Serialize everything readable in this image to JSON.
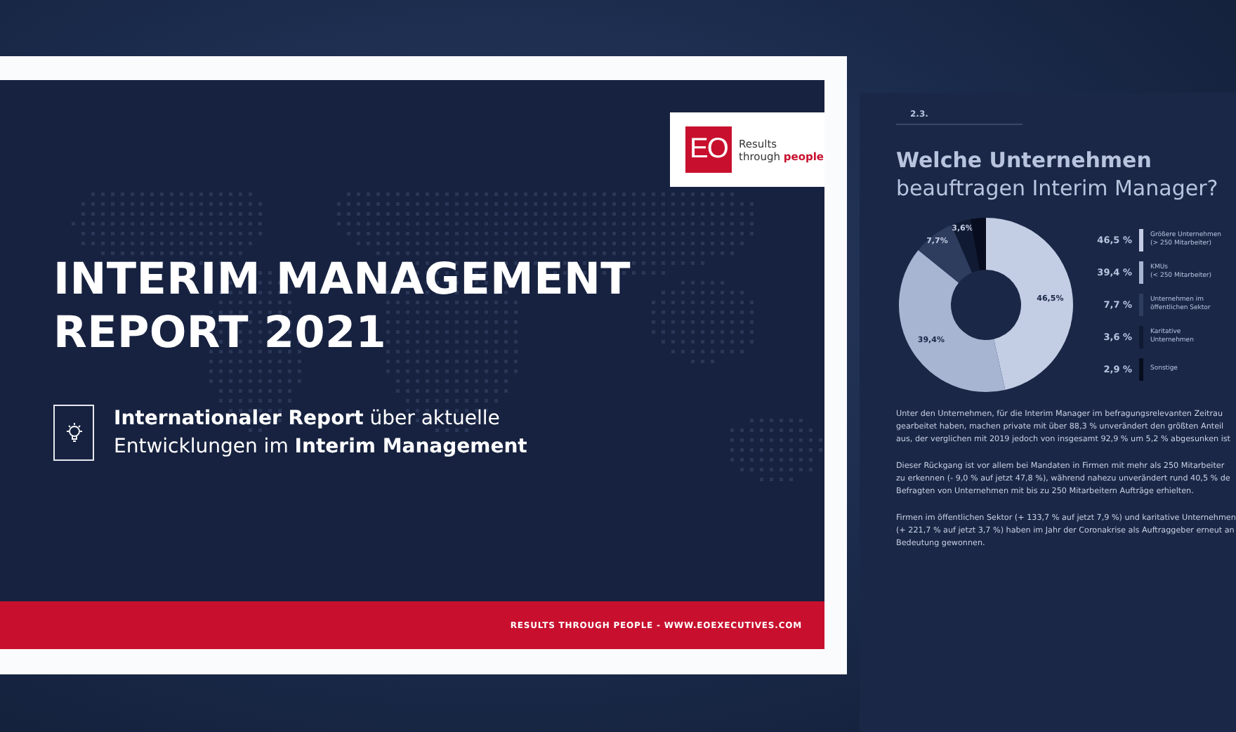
{
  "cover": {
    "logo": {
      "mark": "EO",
      "line_1": "Results",
      "line_2": "through **people**"
    },
    "title_lines": [
      "INTERIM MANAGEMENT",
      "REPORT 2021"
    ],
    "subtitle": "**Internationaler Report** über aktuelle Entwicklungen im **Interim Management**",
    "footer": "RESULTS THROUGH PEOPLE - WWW.EOEXECUTIVES.COM"
  },
  "page": {
    "section": "2.3.",
    "title_bold": "Welche Unternehmen",
    "title_light": "beauftragen Interim Manager?",
    "chart_data": {
      "type": "donut",
      "values": [
        46.5,
        39.4,
        7.7,
        3.6,
        2.9
      ],
      "value_labels": [
        "46,5%",
        "39,4%",
        "7,7%",
        "3,6%",
        null
      ]
    },
    "legend": [
      {
        "value": "46,5 %",
        "lines": [
          "Größere Unternehmen",
          "(> 250 Mitarbeiter)"
        ],
        "color": "#c3cde4"
      },
      {
        "value": "39,4 %",
        "lines": [
          "KMUs",
          "(< 250 Mitarbeiter)"
        ],
        "color": "#a7b4d2"
      },
      {
        "value": "7,7 %",
        "lines": [
          "Unternehmen im",
          "öffentlichen Sektor"
        ],
        "color": "#2e3c5e"
      },
      {
        "value": "3,6 %",
        "lines": [
          "Karitative",
          "Unternehmen"
        ],
        "color": "#101a33"
      },
      {
        "value": "2,9 %",
        "lines": [
          "Sonstige"
        ],
        "color": "#070d1e"
      }
    ],
    "paragraphs": [
      [
        "Unter den Unternehmen, für die Interim Manager im befragungsrelevanten Zeitrau",
        "gearbeitet haben, machen private mit über 88,3 % unverändert den größten Anteil",
        "aus, der verglichen mit 2019 jedoch von insgesamt 92,9 % um 5,2 % abgesunken ist"
      ],
      [
        "Dieser Rückgang ist vor allem bei Mandaten in Firmen mit mehr als 250 Mitarbeiter",
        "zu erkennen (- 9,0 % auf jetzt 47,8 %), während nahezu unverändert rund 40,5 % de",
        "Befragten von Unternehmen mit bis zu 250 Mitarbeitern Aufträge erhielten."
      ],
      [
        "Firmen im öffentlichen Sektor (+ 133,7 % auf jetzt 7,9 %) und karitative Unternehmen",
        "(+ 221,7 % auf jetzt 3,7 %) haben im Jahr der Coronakrise als Auftraggeber erneut an",
        "Bedeutung gewonnen."
      ]
    ]
  }
}
